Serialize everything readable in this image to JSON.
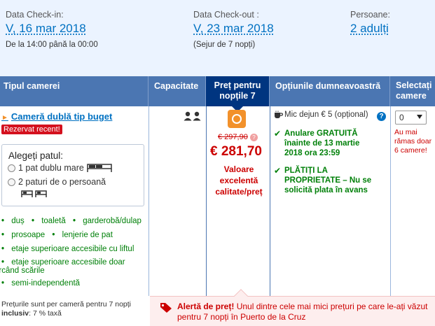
{
  "dates": {
    "checkin_label": "Data Check-in:",
    "checkin_value": "V, 16 mar 2018",
    "checkin_note": "De la 14:00 până la 00:00",
    "checkout_label": "Data Check-out :",
    "checkout_value": "V, 23 mar 2018",
    "checkout_note": "(Sejur de 7 nopți)",
    "guests_label": "Persoane:",
    "guests_value": "2 adulți"
  },
  "table": {
    "headers": {
      "room_type": "Tipul camerei",
      "capacity": "Capacitate",
      "price_line1": "Preț pentru",
      "price_line2": "nopțile 7",
      "options": "Opțiunile dumneavoastră",
      "select_line1": "Selectați",
      "select_line2": "camere"
    }
  },
  "room": {
    "name": "Cameră dublă tip buget",
    "booked_badge": "Rezervat recent!",
    "bed_title": "Alegeți patul:",
    "bed_option1": "1 pat dublu mare",
    "bed_option2": "2 paturi de o persoană",
    "facilities_row1": [
      "duș",
      "toaletă",
      "garderobă/dulap"
    ],
    "facilities_row2": [
      "prosoape",
      "lenjerie de pat"
    ],
    "facility_lift": "etaje superioare accesibile cu liftul",
    "facility_stairs_1": "etaje superioare accesibile doar",
    "facility_stairs_2": "urcând scările",
    "facility_semi": "semi-independentă",
    "price_note_1": "Prețurile sunt per cameră pentru 7 nopți",
    "price_note_2_bold": "inclusiv",
    "price_note_2_rest": ": 7 % taxă"
  },
  "price": {
    "old": "€ 297,90",
    "new": "€ 281,70",
    "value_label": "Valoare excelentă calitate/preț"
  },
  "options": {
    "breakfast": "Mic dejun € 5 (opțional)",
    "cancel_1": "Anulare GRATUITĂ",
    "cancel_2": "înainte de 13 martie",
    "cancel_3": "2018 ora 23:59",
    "pay_1": "PLĂTIȚI LA",
    "pay_2": "PROPRIETATE – Nu se",
    "pay_3": "solicită plata în avans"
  },
  "select": {
    "value": "0",
    "remaining": "Au mai rămas doar 6 camere!"
  },
  "alert": {
    "title": "Alertă de preț!",
    "text": " Unul dintre cele mai mici prețuri pe care le-ați văzut pentru 7 nopți în Puerto de la Cruz"
  },
  "colors": {
    "header_bg": "#4b76b2",
    "price_header_bg": "#003580",
    "link_blue": "#0071c2",
    "alert_red": "#cc0000",
    "green": "#008009",
    "badge_orange": "#f2912b"
  }
}
